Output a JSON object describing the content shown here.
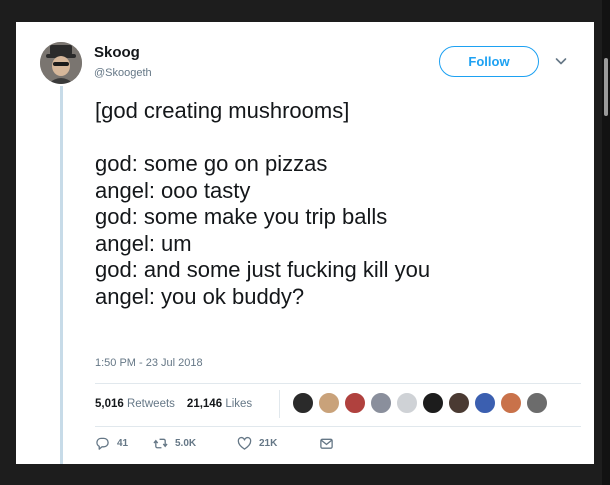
{
  "tweet": {
    "display_name": "Skoog",
    "handle": "@Skoogeth",
    "follow_label": "Follow",
    "lines": [
      "[god creating mushrooms]",
      "",
      "god: some go on pizzas",
      "angel: ooo tasty",
      "god: some make you trip balls",
      "angel: um",
      "god: and some just fucking kill you",
      "angel: you ok buddy?"
    ],
    "timestamp": "1:50 PM - 23 Jul 2018"
  },
  "stats": {
    "retweets_count": "5,016",
    "retweets_label": "Retweets",
    "likes_count": "21,146",
    "likes_label": "Likes"
  },
  "facepile_colors": [
    "#2a2a2a",
    "#c9a27a",
    "#b0413e",
    "#8a8f9c",
    "#cfd2d6",
    "#1c1c1c",
    "#4a3a32",
    "#3b5fb0",
    "#c9724a",
    "#6c6c6c"
  ],
  "actions": {
    "reply_count": "41",
    "retweet_count": "5.0K",
    "like_count": "21K"
  },
  "colors": {
    "accent": "#1da1f2",
    "text": "#14171a",
    "secondary": "#657786"
  }
}
